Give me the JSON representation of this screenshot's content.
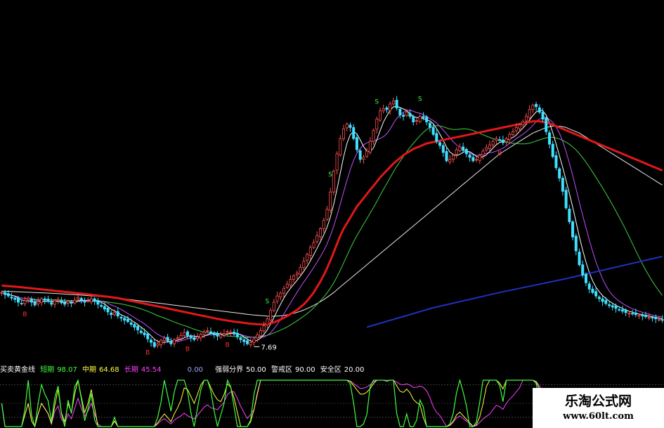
{
  "chart_data": [
    {
      "type": "candlestick",
      "colors": {
        "up": "#ff5050",
        "down": "#40e0ff",
        "ma_short": "#ffffff",
        "ma_mid": "#c050ff",
        "ma_long1": "#40d040",
        "ma_long2": "#e8e8e8",
        "ma_red": "#e01818",
        "ma_blue": "#2030c0"
      },
      "n": 200,
      "close": [
        25.0,
        24.7,
        24.5,
        24.2,
        24.0,
        23.6,
        23.4,
        23.8,
        24.2,
        23.6,
        23.2,
        23.7,
        24.1,
        23.9,
        23.7,
        23.3,
        23.8,
        24.0,
        23.5,
        23.3,
        23.7,
        23.5,
        23.9,
        24.3,
        23.9,
        23.6,
        23.8,
        24.1,
        23.7,
        23.3,
        23.0,
        22.6,
        22.2,
        21.8,
        22.1,
        21.6,
        21.3,
        21.0,
        20.8,
        20.4,
        20.0,
        19.6,
        19.2,
        18.9,
        18.3,
        17.8,
        17.2,
        17.6,
        18.1,
        18.4,
        18.0,
        17.6,
        18.2,
        18.5,
        18.8,
        19.2,
        18.8,
        18.5,
        18.2,
        18.6,
        19.0,
        19.3,
        19.5,
        19.2,
        18.9,
        18.7,
        18.9,
        19.1,
        19.4,
        19.3,
        19.0,
        18.6,
        18.2,
        17.9,
        17.6,
        17.8,
        18.3,
        18.9,
        19.5,
        20.2,
        21.2,
        22.4,
        23.6,
        24.5,
        24.9,
        25.6,
        26.2,
        26.9,
        27.4,
        27.8,
        28.6,
        29.5,
        30.5,
        31.5,
        32.2,
        33.2,
        34.2,
        35.4,
        37.0,
        39.5,
        42.5,
        45.0,
        47.2,
        48.6,
        49.3,
        48.8,
        47.2,
        45.6,
        44.2,
        44.5,
        45.4,
        46.8,
        48.4,
        50.0,
        51.2,
        51.5,
        51.4,
        52.2,
        52.6,
        51.6,
        50.6,
        50.4,
        51.0,
        50.4,
        49.6,
        49.8,
        50.4,
        50.2,
        49.6,
        48.8,
        47.8,
        46.8,
        46.2,
        45.2,
        44.0,
        44.2,
        44.8,
        45.6,
        46.0,
        45.5,
        45.0,
        44.5,
        44.0,
        44.2,
        44.8,
        45.4,
        45.9,
        46.3,
        46.8,
        47.2,
        47.0,
        46.6,
        47.2,
        47.8,
        48.2,
        48.8,
        49.2,
        49.6,
        50.4,
        51.4,
        52.0,
        51.8,
        51.0,
        50.0,
        48.2,
        46.4,
        44.6,
        43.0,
        41.5,
        39.6,
        37.2,
        35.2,
        33.0,
        31.0,
        29.0,
        27.5,
        26.4,
        25.5,
        25.0,
        24.5,
        24.1,
        23.7,
        23.4,
        23.1,
        22.9,
        22.7,
        22.5,
        22.3,
        22.1,
        22.0,
        21.9,
        21.8,
        21.7,
        21.6,
        21.5,
        21.4,
        21.3,
        21.2,
        21.1,
        21.0
      ],
      "ma_red": [
        26.0,
        25.96,
        25.92,
        25.88,
        25.84,
        25.8,
        25.75,
        25.7,
        25.65,
        25.6,
        25.55,
        25.5,
        25.45,
        25.4,
        25.35,
        25.3,
        25.25,
        25.2,
        25.15,
        25.1,
        25.05,
        25.0,
        24.95,
        24.9,
        24.85,
        24.8,
        24.74,
        24.68,
        24.62,
        24.56,
        24.5,
        24.44,
        24.38,
        24.32,
        24.26,
        24.2,
        24.1,
        24.0,
        23.9,
        23.8,
        23.7,
        23.6,
        23.5,
        23.4,
        23.3,
        23.2,
        23.1,
        23.0,
        22.9,
        22.8,
        22.7,
        22.6,
        22.5,
        22.4,
        22.3,
        22.2,
        22.1,
        22.0,
        21.9,
        21.8,
        21.7,
        21.6,
        21.5,
        21.4,
        21.3,
        21.2,
        21.12,
        21.04,
        20.96,
        20.88,
        20.8,
        20.74,
        20.68,
        20.62,
        20.56,
        20.5,
        20.46,
        20.42,
        20.4,
        20.4,
        20.45,
        20.55,
        20.7,
        20.9,
        21.1,
        21.35,
        21.6,
        21.9,
        22.2,
        22.5,
        22.9,
        23.3,
        23.8,
        24.4,
        25.0,
        25.8,
        26.6,
        27.5,
        28.5,
        29.6,
        30.8,
        32.0,
        33.2,
        34.2,
        35.0,
        35.8,
        36.6,
        37.4,
        38.0,
        38.6,
        39.2,
        39.8,
        40.4,
        41.0,
        41.6,
        42.1,
        42.6,
        43.1,
        43.6,
        44.0,
        44.4,
        44.8,
        45.1,
        45.4,
        45.7,
        45.9,
        46.1,
        46.3,
        46.5,
        46.6,
        46.7,
        46.8,
        46.9,
        47.0,
        47.1,
        47.2,
        47.3,
        47.4,
        47.5,
        47.6,
        47.7,
        47.8,
        47.9,
        48.0,
        48.1,
        48.2,
        48.3,
        48.4,
        48.5,
        48.6,
        48.7,
        48.8,
        48.9,
        49.0,
        49.1,
        49.2,
        49.3,
        49.4,
        49.5,
        49.6,
        49.7,
        49.7,
        49.7,
        49.6,
        49.5,
        49.4,
        49.2,
        49.0,
        48.8,
        48.6,
        48.4,
        48.2,
        48.0,
        47.8,
        47.6,
        47.4,
        47.2,
        47.0,
        46.8,
        46.6,
        46.4,
        46.2,
        46.0,
        45.8,
        45.6,
        45.4,
        45.2,
        45.0,
        44.8,
        44.6,
        44.4,
        44.2,
        44.0,
        43.8,
        43.6,
        43.4,
        43.2,
        43.0,
        42.8,
        42.6
      ],
      "ma_long2": [
        25.2,
        25.18,
        25.16,
        25.14,
        25.12,
        25.1,
        25.08,
        25.06,
        25.04,
        25.02,
        25.0,
        24.98,
        24.96,
        24.94,
        24.92,
        24.9,
        24.87,
        24.84,
        24.81,
        24.78,
        24.75,
        24.72,
        24.69,
        24.66,
        24.63,
        24.6,
        24.56,
        24.52,
        24.48,
        24.44,
        24.4,
        24.36,
        24.32,
        24.28,
        24.24,
        24.2,
        24.14,
        24.08,
        24.02,
        23.96,
        23.9,
        23.84,
        23.78,
        23.72,
        23.66,
        23.6,
        23.54,
        23.48,
        23.42,
        23.36,
        23.3,
        23.24,
        23.18,
        23.12,
        23.06,
        23.0,
        22.94,
        22.88,
        22.82,
        22.76,
        22.7,
        22.64,
        22.58,
        22.52,
        22.46,
        22.4,
        22.34,
        22.28,
        22.22,
        22.16,
        22.1,
        22.04,
        21.98,
        21.92,
        21.86,
        21.8,
        21.76,
        21.72,
        21.68,
        21.64,
        21.6,
        21.58,
        21.58,
        21.6,
        21.64,
        21.7,
        21.78,
        21.88,
        22.0,
        22.14,
        22.3,
        22.48,
        22.68,
        22.9,
        23.14,
        23.4,
        23.68,
        23.98,
        24.3,
        24.64,
        25.0,
        25.4,
        25.8,
        26.2,
        26.6,
        27.0,
        27.4,
        27.8,
        28.2,
        28.6,
        29.0,
        29.4,
        29.8,
        30.2,
        30.6,
        31.0,
        31.4,
        31.8,
        32.2,
        32.6,
        33.0,
        33.4,
        33.8,
        34.2,
        34.6,
        35.0,
        35.4,
        35.8,
        36.2,
        36.6,
        37.0,
        37.4,
        37.8,
        38.2,
        38.6,
        39.0,
        39.4,
        39.8,
        40.2,
        40.6,
        41.0,
        41.4,
        41.8,
        42.2,
        42.6,
        43.0,
        43.4,
        43.8,
        44.2,
        44.6,
        45.0,
        45.3,
        45.6,
        45.9,
        46.2,
        46.5,
        46.8,
        47.1,
        47.4,
        47.7,
        48.0,
        48.2,
        48.4,
        48.6,
        48.8,
        48.9,
        49.0,
        49.0,
        49.0,
        48.9,
        48.8,
        48.6,
        48.4,
        48.2,
        48.0,
        47.7,
        47.4,
        47.1,
        46.8,
        46.5,
        46.2,
        45.9,
        45.6,
        45.3,
        45.0,
        44.7,
        44.4,
        44.1,
        43.8,
        43.5,
        43.2,
        42.9,
        42.6,
        42.3,
        42.0,
        41.7,
        41.4,
        41.1,
        40.8,
        40.5
      ],
      "ma_blue": {
        "x": [
          110,
          130,
          150,
          170,
          199
        ],
        "y": [
          20.0,
          22.8,
          25.0,
          27.0,
          30.2
        ]
      },
      "markers": [
        {
          "i": 7,
          "label": "B",
          "color": "#ff3030",
          "pos": "below"
        },
        {
          "i": 44,
          "label": "B",
          "color": "#ff3030",
          "pos": "below"
        },
        {
          "i": 56,
          "label": "B",
          "color": "#ff3030",
          "pos": "below"
        },
        {
          "i": 68,
          "label": "B",
          "color": "#ff3030",
          "pos": "below"
        },
        {
          "i": 80,
          "label": "S",
          "color": "#40ff40",
          "pos": "above"
        },
        {
          "i": 99,
          "label": "S",
          "color": "#40ff40",
          "pos": "above"
        },
        {
          "i": 113,
          "label": "S",
          "color": "#40ff40",
          "pos": "above"
        },
        {
          "i": 126,
          "label": "S",
          "color": "#40ff40",
          "pos": "above"
        },
        {
          "i": 150,
          "label": "B",
          "color": "#ff3030",
          "pos": "below"
        }
      ],
      "annotation": {
        "i": 76,
        "text": "7.69"
      },
      "y_range": [
        16,
        53
      ]
    },
    {
      "type": "line",
      "title": "买卖黄金线",
      "series": [
        {
          "name": "短期",
          "value": "98.07",
          "color": "#40ff40"
        },
        {
          "name": "中期",
          "value": "64.68",
          "color": "#ffff40"
        },
        {
          "name": "长期",
          "value": "45.54",
          "color": "#ff40ff"
        }
      ],
      "extra": [
        {
          "name": "强弱分界",
          "value": "50.00"
        },
        {
          "name": "警戒区",
          "value": "90.00"
        },
        {
          "name": "安全区",
          "value": "20.00"
        }
      ],
      "extra_value": "0.00",
      "ylim": [
        0,
        100
      ]
    }
  ],
  "watermark": {
    "line1": "乐淘公式网",
    "line2": "www.60lt.com"
  }
}
